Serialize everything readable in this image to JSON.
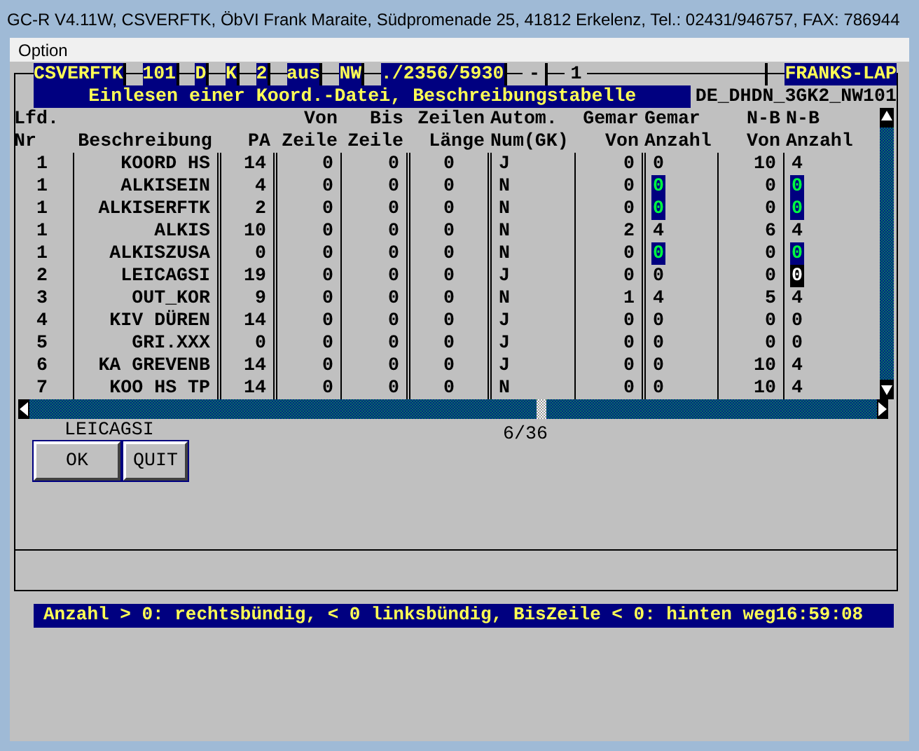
{
  "window": {
    "title": "GC-R V4.11W, CSVERFTK, ÖbVI Frank Maraite, Südpromenade 25, 41812 Erkelenz, Tel.: 02431/946757, FAX: 786944"
  },
  "menu": [
    "Option"
  ],
  "top_fields": [
    {
      "text": "CSVERFTK",
      "highlighted": true
    },
    {
      "text": "101",
      "highlighted": true
    },
    {
      "text": "D",
      "highlighted": true
    },
    {
      "text": "K",
      "highlighted": true
    },
    {
      "text": "2",
      "highlighted": true
    },
    {
      "text": "aus",
      "highlighted": true
    },
    {
      "text": "NW",
      "highlighted": true
    },
    {
      "text": "./2356/5930",
      "highlighted": true
    },
    {
      "text": "-",
      "highlighted": false
    },
    {
      "text": "1",
      "highlighted": false
    },
    {
      "text": "FRANKS-LAP",
      "highlighted": true
    }
  ],
  "heading": {
    "title": "Einlesen einer Koord.-Datei, Beschreibungstabelle",
    "file": "DE_DHDN_3GK2_NW101"
  },
  "table": {
    "columns": [
      {
        "line1": "Lfd.",
        "line2": "Nr"
      },
      {
        "line2": "Beschreibung"
      },
      {
        "line2": "PA"
      },
      {
        "line1": "Von",
        "line2": "Zeile"
      },
      {
        "line1": "Bis",
        "line2": "Zeile"
      },
      {
        "line1": "Zeilen",
        "line2": "Länge"
      },
      {
        "line1": "Autom.",
        "line2": "Num(GK)"
      },
      {
        "line1": "Gemar",
        "line2": "Von"
      },
      {
        "line1": "Gemar",
        "line2": "Anzahl"
      },
      {
        "line1": "N-B",
        "line2": "Von"
      },
      {
        "line1": "N-B",
        "line2": "Anzahl"
      }
    ],
    "rows": [
      {
        "cells": [
          "1",
          "KOORD HS",
          "14",
          "0",
          "0",
          "0",
          "J",
          "0",
          "0",
          "10",
          "4"
        ],
        "gemar_anzahl_edit": false,
        "nb_anzahl_edit": false,
        "nb_anzahl_cursor": false
      },
      {
        "cells": [
          "1",
          "ALKISEIN",
          "4",
          "0",
          "0",
          "0",
          "N",
          "0",
          "0",
          "0",
          "0"
        ],
        "gemar_anzahl_edit": true,
        "nb_anzahl_edit": true,
        "nb_anzahl_cursor": false
      },
      {
        "cells": [
          "1",
          "ALKISERFTK",
          "2",
          "0",
          "0",
          "0",
          "N",
          "0",
          "0",
          "0",
          "0"
        ],
        "gemar_anzahl_edit": true,
        "nb_anzahl_edit": true,
        "nb_anzahl_cursor": false
      },
      {
        "cells": [
          "1",
          "ALKIS",
          "10",
          "0",
          "0",
          "0",
          "N",
          "2",
          "4",
          "6",
          "4"
        ],
        "gemar_anzahl_edit": false,
        "nb_anzahl_edit": false,
        "nb_anzahl_cursor": false
      },
      {
        "cells": [
          "1",
          "ALKISZUSA",
          "0",
          "0",
          "0",
          "0",
          "N",
          "0",
          "0",
          "0",
          "0"
        ],
        "gemar_anzahl_edit": true,
        "nb_anzahl_edit": true,
        "nb_anzahl_cursor": false
      },
      {
        "cells": [
          "2",
          "LEICAGSI",
          "19",
          "0",
          "0",
          "0",
          "J",
          "0",
          "0",
          "0",
          "0"
        ],
        "gemar_anzahl_edit": false,
        "nb_anzahl_edit": false,
        "nb_anzahl_cursor": true
      },
      {
        "cells": [
          "3",
          "OUT_KOR",
          "9",
          "0",
          "0",
          "0",
          "N",
          "1",
          "4",
          "5",
          "4"
        ],
        "gemar_anzahl_edit": false,
        "nb_anzahl_edit": false,
        "nb_anzahl_cursor": false
      },
      {
        "cells": [
          "4",
          "KIV DÜREN",
          "14",
          "0",
          "0",
          "0",
          "J",
          "0",
          "0",
          "0",
          "0"
        ],
        "gemar_anzahl_edit": false,
        "nb_anzahl_edit": false,
        "nb_anzahl_cursor": false
      },
      {
        "cells": [
          "5",
          "GRI.XXX",
          "0",
          "0",
          "0",
          "0",
          "J",
          "0",
          "0",
          "0",
          "0"
        ],
        "gemar_anzahl_edit": false,
        "nb_anzahl_edit": false,
        "nb_anzahl_cursor": false
      },
      {
        "cells": [
          "6",
          "KA GREVENB",
          "14",
          "0",
          "0",
          "0",
          "J",
          "0",
          "0",
          "10",
          "4"
        ],
        "gemar_anzahl_edit": false,
        "nb_anzahl_edit": false,
        "nb_anzahl_cursor": false
      },
      {
        "cells": [
          "7",
          "KOO HS TP",
          "14",
          "0",
          "0",
          "0",
          "N",
          "0",
          "0",
          "10",
          "4"
        ],
        "gemar_anzahl_edit": false,
        "nb_anzahl_edit": false,
        "nb_anzahl_cursor": false
      }
    ]
  },
  "group": {
    "label": "LEICAGSI",
    "buttons": [
      "OK",
      "QUIT"
    ]
  },
  "counter": "6/36",
  "status_bar": {
    "text": "Anzahl > 0: rechtsbündig, < 0 linksbündig, BisZeile < 0: hinten weg",
    "time": "16:59:08"
  }
}
